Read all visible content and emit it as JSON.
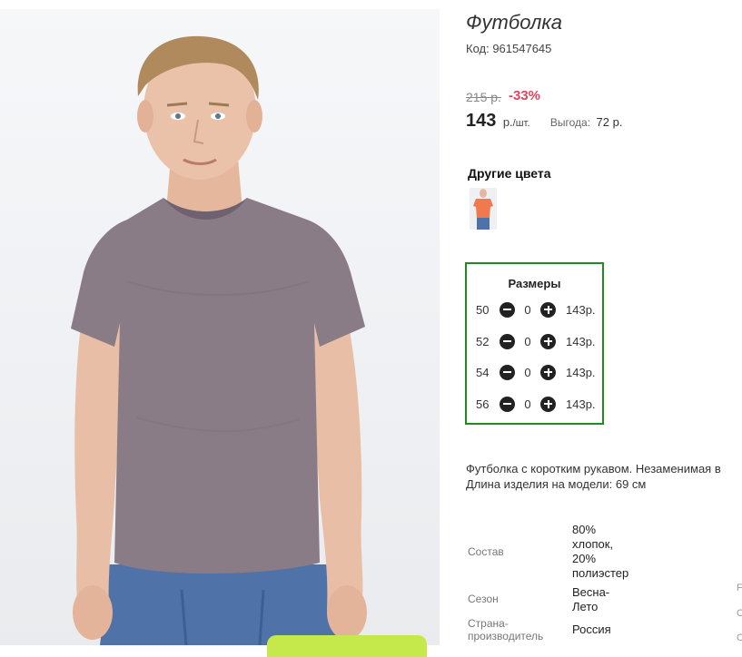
{
  "product": {
    "title": "Футболка",
    "code": "Код: 961547645",
    "old_price": "215 р.",
    "discount": "-33%",
    "price": "143",
    "unit_main": "р.",
    "unit_sub": "/шт.",
    "benefit_label": "Выгода:",
    "benefit_value": "72 р."
  },
  "other_colors": {
    "heading": "Другие цвета",
    "items": [
      {
        "color": "#f07a4e"
      }
    ]
  },
  "sizes": {
    "heading": "Размеры",
    "rows": [
      {
        "size": "50",
        "qty": "0",
        "price": "143р."
      },
      {
        "size": "52",
        "qty": "0",
        "price": "143р."
      },
      {
        "size": "54",
        "qty": "0",
        "price": "143р."
      },
      {
        "size": "56",
        "qty": "0",
        "price": "143р."
      }
    ]
  },
  "description": {
    "line1": "Футболка с коротким рукавом. Незаменимая в",
    "line2": "Длина изделия на модели: 69 см"
  },
  "attributes": {
    "composition_label": "Состав",
    "composition_value": [
      "80%",
      "хлопок,",
      "20%",
      "полиэстер"
    ],
    "season_label": "Сезон",
    "season_value": [
      "Весна-",
      "Лето"
    ],
    "country_label": [
      "Страна-",
      "производитель"
    ],
    "country_value": "Россия"
  },
  "edge_chars": [
    "F",
    "С",
    "С"
  ],
  "colors": {
    "accent_green": "#1f8a1f",
    "discount_red": "#e0455d",
    "cart_green": "#c5e84a",
    "shirt": "#8a7c86"
  }
}
